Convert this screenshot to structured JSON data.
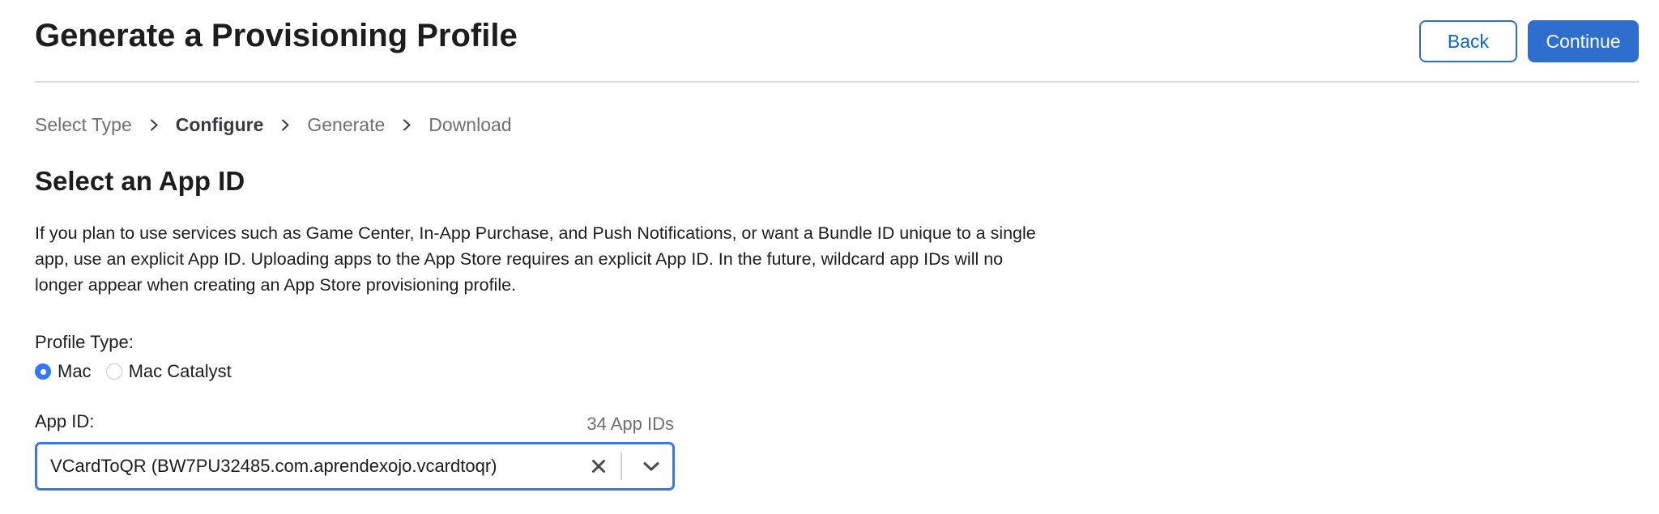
{
  "header": {
    "title": "Generate a Provisioning Profile",
    "back_label": "Back",
    "continue_label": "Continue"
  },
  "breadcrumb": {
    "steps": [
      {
        "label": "Select Type",
        "active": false
      },
      {
        "label": "Configure",
        "active": true
      },
      {
        "label": "Generate",
        "active": false
      },
      {
        "label": "Download",
        "active": false
      }
    ],
    "separator_icon": "chevron-right-icon"
  },
  "section": {
    "title": "Select an App ID",
    "description": "If you plan to use services such as Game Center, In-App Purchase, and Push Notifications, or want a Bundle ID unique to a single app, use an explicit App ID. Uploading apps to the App Store requires an explicit App ID. In the future, wildcard app IDs will no longer appear when creating an App Store provisioning profile."
  },
  "profile_type": {
    "label": "Profile Type:",
    "options": [
      {
        "label": "Mac",
        "selected": true
      },
      {
        "label": "Mac Catalyst",
        "selected": false
      }
    ]
  },
  "app_id": {
    "label": "App ID:",
    "count": "34 App IDs",
    "selected_value": "VCardToQR (BW7PU32485.com.aprendexojo.vcardtoqr)",
    "clear_icon": "close-icon",
    "dropdown_icon": "chevron-down-icon"
  },
  "colors": {
    "accent": "#2e6fcd",
    "focus_border": "#3a78e0",
    "radio_selected": "#3478f6",
    "muted_text": "#6e6e73"
  }
}
